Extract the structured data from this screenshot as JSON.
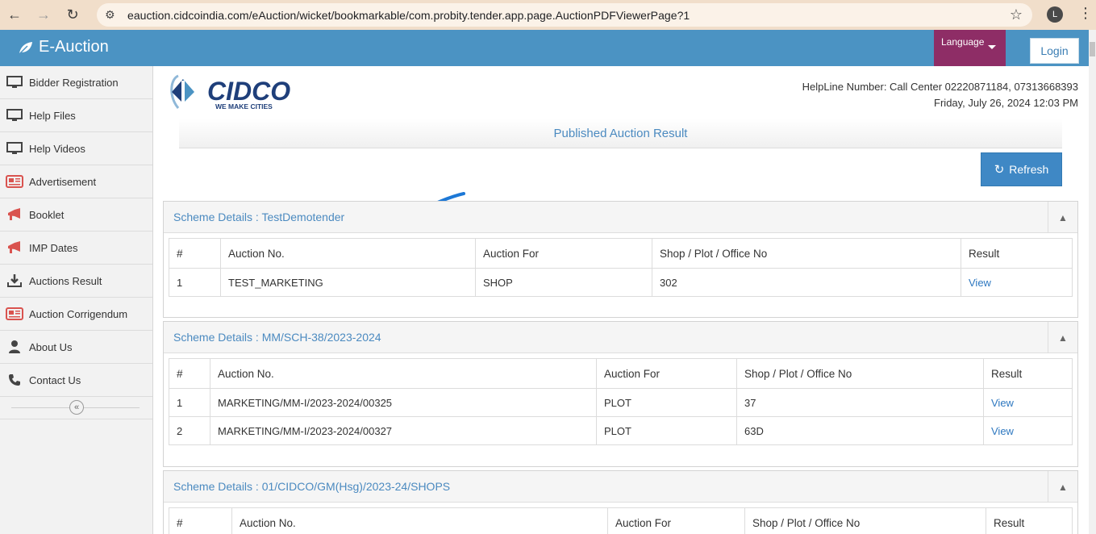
{
  "browser": {
    "url": "eauction.cidcoindia.com/eAuction/wicket/bookmarkable/com.probity.tender.app.page.AuctionPDFViewerPage?1",
    "profile_initial": "L"
  },
  "header": {
    "app_title": "E-Auction",
    "language_label": "Language",
    "login_label": "Login",
    "accent_color": "#4b93c3",
    "language_color": "#8e2d66"
  },
  "sidebar": {
    "items": [
      {
        "label": "Bidder Registration",
        "icon": "monitor-icon"
      },
      {
        "label": "Help Files",
        "icon": "monitor-icon"
      },
      {
        "label": "Help Videos",
        "icon": "monitor-icon"
      },
      {
        "label": "Advertisement",
        "icon": "newspaper-icon"
      },
      {
        "label": "Booklet",
        "icon": "megaphone-icon"
      },
      {
        "label": "IMP Dates",
        "icon": "megaphone-icon"
      },
      {
        "label": "Auctions Result",
        "icon": "download-icon"
      },
      {
        "label": "Auction Corrigendum",
        "icon": "newspaper-icon"
      },
      {
        "label": "About Us",
        "icon": "user-icon"
      },
      {
        "label": "Contact Us",
        "icon": "phone-icon"
      }
    ]
  },
  "main": {
    "logo_text": "CIDCO",
    "logo_tagline": "WE MAKE CITIES",
    "helpline": "HelpLine Number: Call Center 02220871184, 07313668393",
    "datetime": "Friday, July 26, 2024 12:03 PM",
    "page_title": "Published Auction Result",
    "refresh_label": "Refresh",
    "columns": [
      "#",
      "Auction No.",
      "Auction For",
      "Shop / Plot / Office No",
      "Result"
    ],
    "schemes": [
      {
        "title": "Scheme Details : TestDemotender",
        "rows": [
          [
            "1",
            "TEST_MARKETING",
            "SHOP",
            "302",
            "View"
          ]
        ]
      },
      {
        "title": "Scheme Details : MM/SCH-38/2023-2024",
        "rows": [
          [
            "1",
            "MARKETING/MM-I/2023-2024/00325",
            "PLOT",
            "37",
            "View"
          ],
          [
            "2",
            "MARKETING/MM-I/2023-2024/00327",
            "PLOT",
            "63D",
            "View"
          ]
        ]
      },
      {
        "title": "Scheme Details : 01/CIDCO/GM(Hsg)/2023-24/SHOPS",
        "rows": []
      }
    ]
  }
}
